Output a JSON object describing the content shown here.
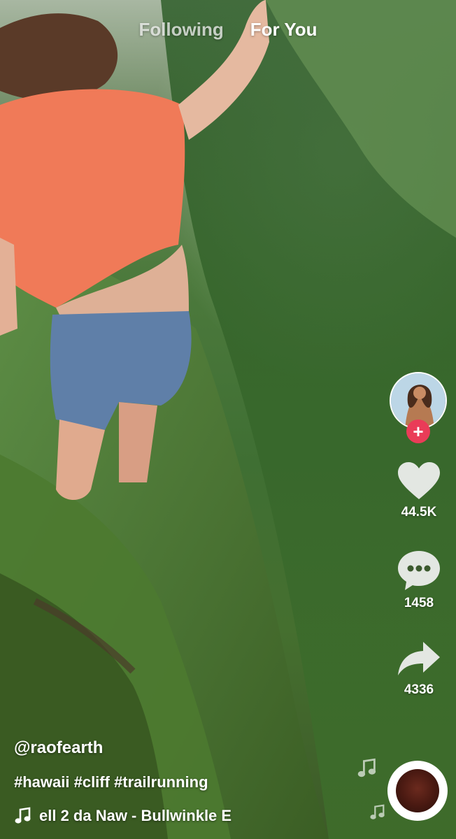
{
  "colors": {
    "accent_follow": "#ea3c58",
    "text": "#ffffff"
  },
  "header": {
    "tabs": [
      {
        "label": "Following",
        "active": false
      },
      {
        "label": "For You",
        "active": true
      }
    ]
  },
  "actions": {
    "avatar": {
      "icon": "creator-avatar",
      "follow_icon": "plus-icon",
      "follow_symbol": "+"
    },
    "like": {
      "icon": "heart-icon",
      "count": "44.5K"
    },
    "comment": {
      "icon": "comment-bubble-icon",
      "count": "1458"
    },
    "share": {
      "icon": "share-arrow-icon",
      "count": "4336"
    }
  },
  "post": {
    "username": "@raofearth",
    "caption": "#hawaii #cliff #trailrunning",
    "sound": "ell 2 da Naw - Bullwinkle E",
    "sound_icon": "music-note-icon",
    "disc_icon": "music-disc-icon"
  }
}
